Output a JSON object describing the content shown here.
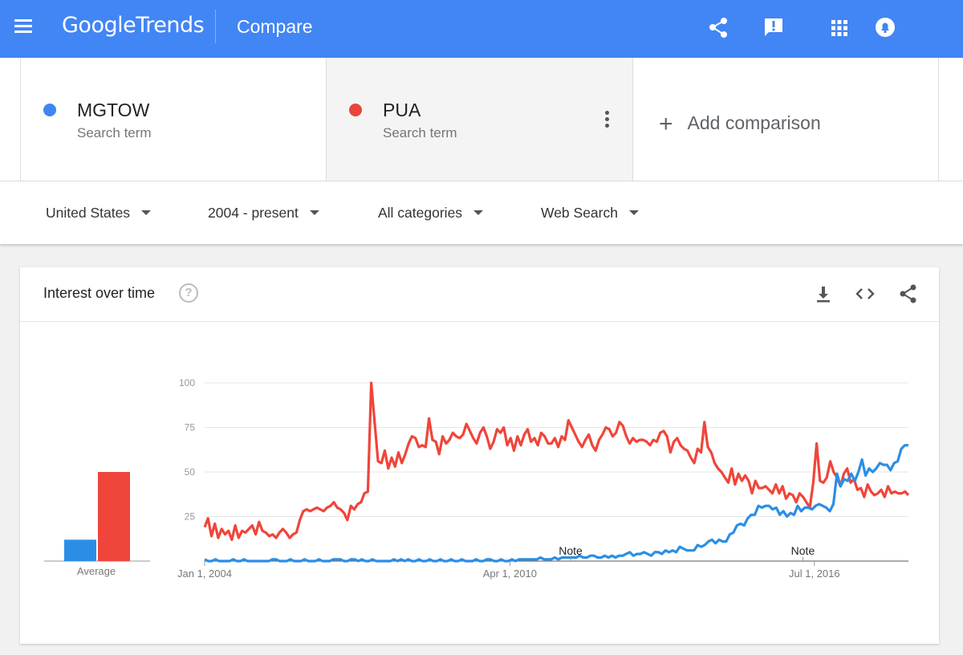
{
  "app": {
    "logo_google": "Google",
    "logo_trends": "Trends",
    "page_title": "Compare"
  },
  "colors": {
    "brand_blue": "#4285f4",
    "series_blue": "#2b8ee6",
    "series_red": "#f0453a"
  },
  "terms": [
    {
      "name": "MGTOW",
      "subtitle": "Search term",
      "color": "#3f86f0"
    },
    {
      "name": "PUA",
      "subtitle": "Search term",
      "color": "#e8453c"
    }
  ],
  "add_comparison": "Add comparison",
  "filters": {
    "region": "United States",
    "time": "2004 - present",
    "category": "All categories",
    "search_type": "Web Search"
  },
  "card": {
    "title": "Interest over time",
    "help": "?"
  },
  "icons": [
    "menu-icon",
    "share-icon",
    "feedback-icon",
    "apps-icon",
    "notifications-icon",
    "kebab-icon",
    "add-icon",
    "help-icon",
    "download-icon",
    "embed-icon",
    "share-icon"
  ],
  "chart_data": {
    "type": "line",
    "ylim": [
      0,
      100
    ],
    "yticks": [
      25,
      50,
      75,
      100
    ],
    "xtick_labels": [
      "Jan 1, 2004",
      "Apr 1, 2010",
      "Jul 1, 2016"
    ],
    "notes": [
      "Note",
      "Note"
    ],
    "average_label": "Average",
    "averages": [
      {
        "term": "MGTOW",
        "value": 12
      },
      {
        "term": "PUA",
        "value": 50
      }
    ],
    "series": [
      {
        "name": "PUA",
        "values": [
          19,
          24,
          14,
          21,
          13,
          18,
          15,
          17,
          12,
          20,
          13,
          17,
          16,
          18,
          20,
          15,
          22,
          17,
          16,
          14,
          15,
          13,
          16,
          18,
          16,
          13,
          15,
          16,
          23,
          28,
          29,
          28,
          29,
          30,
          29,
          28,
          30,
          31,
          33,
          30,
          29,
          27,
          23,
          31,
          29,
          32,
          33,
          38,
          39,
          100,
          78,
          56,
          55,
          62,
          52,
          58,
          53,
          61,
          55,
          60,
          66,
          70,
          69,
          64,
          65,
          64,
          80,
          68,
          67,
          60,
          70,
          66,
          68,
          72,
          70,
          69,
          71,
          77,
          73,
          69,
          66,
          72,
          75,
          70,
          63,
          67,
          74,
          72,
          75,
          65,
          69,
          62,
          70,
          65,
          71,
          74,
          67,
          69,
          65,
          72,
          70,
          66,
          66,
          69,
          64,
          70,
          68,
          79,
          75,
          71,
          67,
          64,
          68,
          71,
          65,
          62,
          68,
          71,
          75,
          74,
          70,
          72,
          78,
          76,
          70,
          66,
          69,
          67,
          68,
          68,
          67,
          65,
          68,
          67,
          72,
          73,
          70,
          61,
          67,
          69,
          65,
          63,
          62,
          58,
          55,
          63,
          61,
          78,
          64,
          61,
          55,
          52,
          50,
          47,
          44,
          52,
          43,
          49,
          45,
          48,
          45,
          38,
          45,
          41,
          41,
          42,
          40,
          38,
          43,
          38,
          42,
          35,
          38,
          37,
          33,
          38,
          36,
          33,
          30,
          44,
          66,
          45,
          44,
          47,
          56,
          50,
          47,
          42,
          49,
          52,
          44,
          46,
          40,
          41,
          36,
          43,
          39,
          37,
          38,
          40,
          36,
          42,
          38,
          39,
          38,
          38,
          39,
          37
        ]
      },
      {
        "name": "MGTOW",
        "values": [
          1,
          0,
          0,
          1,
          0,
          0,
          0,
          0,
          1,
          0,
          0,
          1,
          0,
          0,
          0,
          0,
          0,
          0,
          0,
          1,
          1,
          0,
          0,
          0,
          1,
          0,
          0,
          0,
          1,
          0,
          0,
          0,
          1,
          0,
          0,
          0,
          1,
          1,
          1,
          0,
          0,
          1,
          1,
          0,
          1,
          0,
          0,
          1,
          0,
          0,
          0,
          0,
          0,
          1,
          0,
          1,
          0,
          1,
          0,
          0,
          1,
          0,
          0,
          1,
          0,
          0,
          1,
          0,
          0,
          1,
          0,
          0,
          1,
          0,
          0,
          0,
          1,
          0,
          0,
          1,
          1,
          0,
          0,
          1,
          0,
          0,
          1,
          0,
          1,
          1,
          1,
          1,
          1,
          1,
          2,
          1,
          1,
          1,
          2,
          1,
          2,
          2,
          2,
          2,
          2,
          3,
          2,
          2,
          3,
          3,
          2,
          2,
          3,
          2,
          3,
          2,
          3,
          3,
          4,
          5,
          3,
          4,
          4,
          5,
          4,
          3,
          5,
          5,
          4,
          6,
          5,
          6,
          5,
          8,
          7,
          6,
          6,
          6,
          9,
          8,
          9,
          11,
          12,
          10,
          12,
          11,
          11,
          15,
          16,
          20,
          21,
          20,
          24,
          26,
          26,
          31,
          30,
          31,
          31,
          29,
          30,
          26,
          28,
          25,
          27,
          26,
          31,
          28,
          30,
          30,
          29,
          31,
          32,
          31,
          30,
          28,
          32,
          49,
          42,
          46,
          45,
          49,
          45,
          50,
          57,
          48,
          52,
          50,
          52,
          55,
          54,
          54,
          51,
          55,
          56,
          63,
          65,
          65
        ]
      }
    ]
  }
}
